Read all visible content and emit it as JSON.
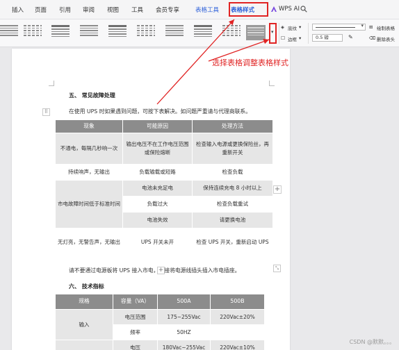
{
  "menubar": {
    "tabs": [
      "插入",
      "页面",
      "引用",
      "审阅",
      "视图",
      "工具",
      "会员专享",
      "表格工具",
      "表格样式"
    ],
    "ai_label": "WPS AI"
  },
  "ribbon": {
    "shading_label": "底纹",
    "border_label": "边框",
    "line_width": "0.5 磅",
    "draw_table_label": "绘制表格",
    "eraser_label": "删除表头"
  },
  "annotation": "选择表格调整表格样式",
  "doc": {
    "section5_title": "五、 常见故障处理",
    "intro": "在使用 UPS 时如果遇到问题，可按下表解决。如问题严重请与代理商联系。",
    "table1": {
      "headers": [
        "现象",
        "可能原因",
        "处理方法"
      ],
      "r1": {
        "c1": "不通电，每隔几秒响一次",
        "c2": "输出电压不在工作电压范围或保险熔断",
        "c3": "检查输入电源或更换保险丝，再重新开关"
      },
      "r2": {
        "c1": "持续响声，无输出",
        "c2": "负载输载或短路",
        "c3": "检查负载"
      },
      "r3": {
        "c1": "市电故障时间低于标准时间",
        "c2a": "电池未充足电",
        "c3a": "保持连续充电 8 小时以上",
        "c2b": "负载过大",
        "c3b": "检查负载重试",
        "c2c": "电池失效",
        "c3c": "请更换电池"
      },
      "r4": {
        "c1": "无灯亮，无警告声，无输出",
        "c2": "UPS 开关未开",
        "c3": "检查 UPS 开关，重新启动 UPS"
      }
    },
    "note": "请不要通过电源板将 UPS 接入市电，直接将电源线插头插入市电插座。",
    "section6_title": "六、 技术指标",
    "table2": {
      "headers": [
        "规格",
        "容量（VA）",
        "500A",
        "500B"
      ],
      "group": "输入",
      "rows": [
        {
          "param": "电压范围",
          "a": "175~255Vac",
          "b": "220Vac±20%"
        },
        {
          "param": "频率",
          "a": "50HZ",
          "b": ""
        },
        {
          "param": "电压",
          "a": "180Vac~255Vac",
          "b": "220Vac±10%"
        }
      ]
    }
  },
  "watermark": "CSDN @默默。。。"
}
